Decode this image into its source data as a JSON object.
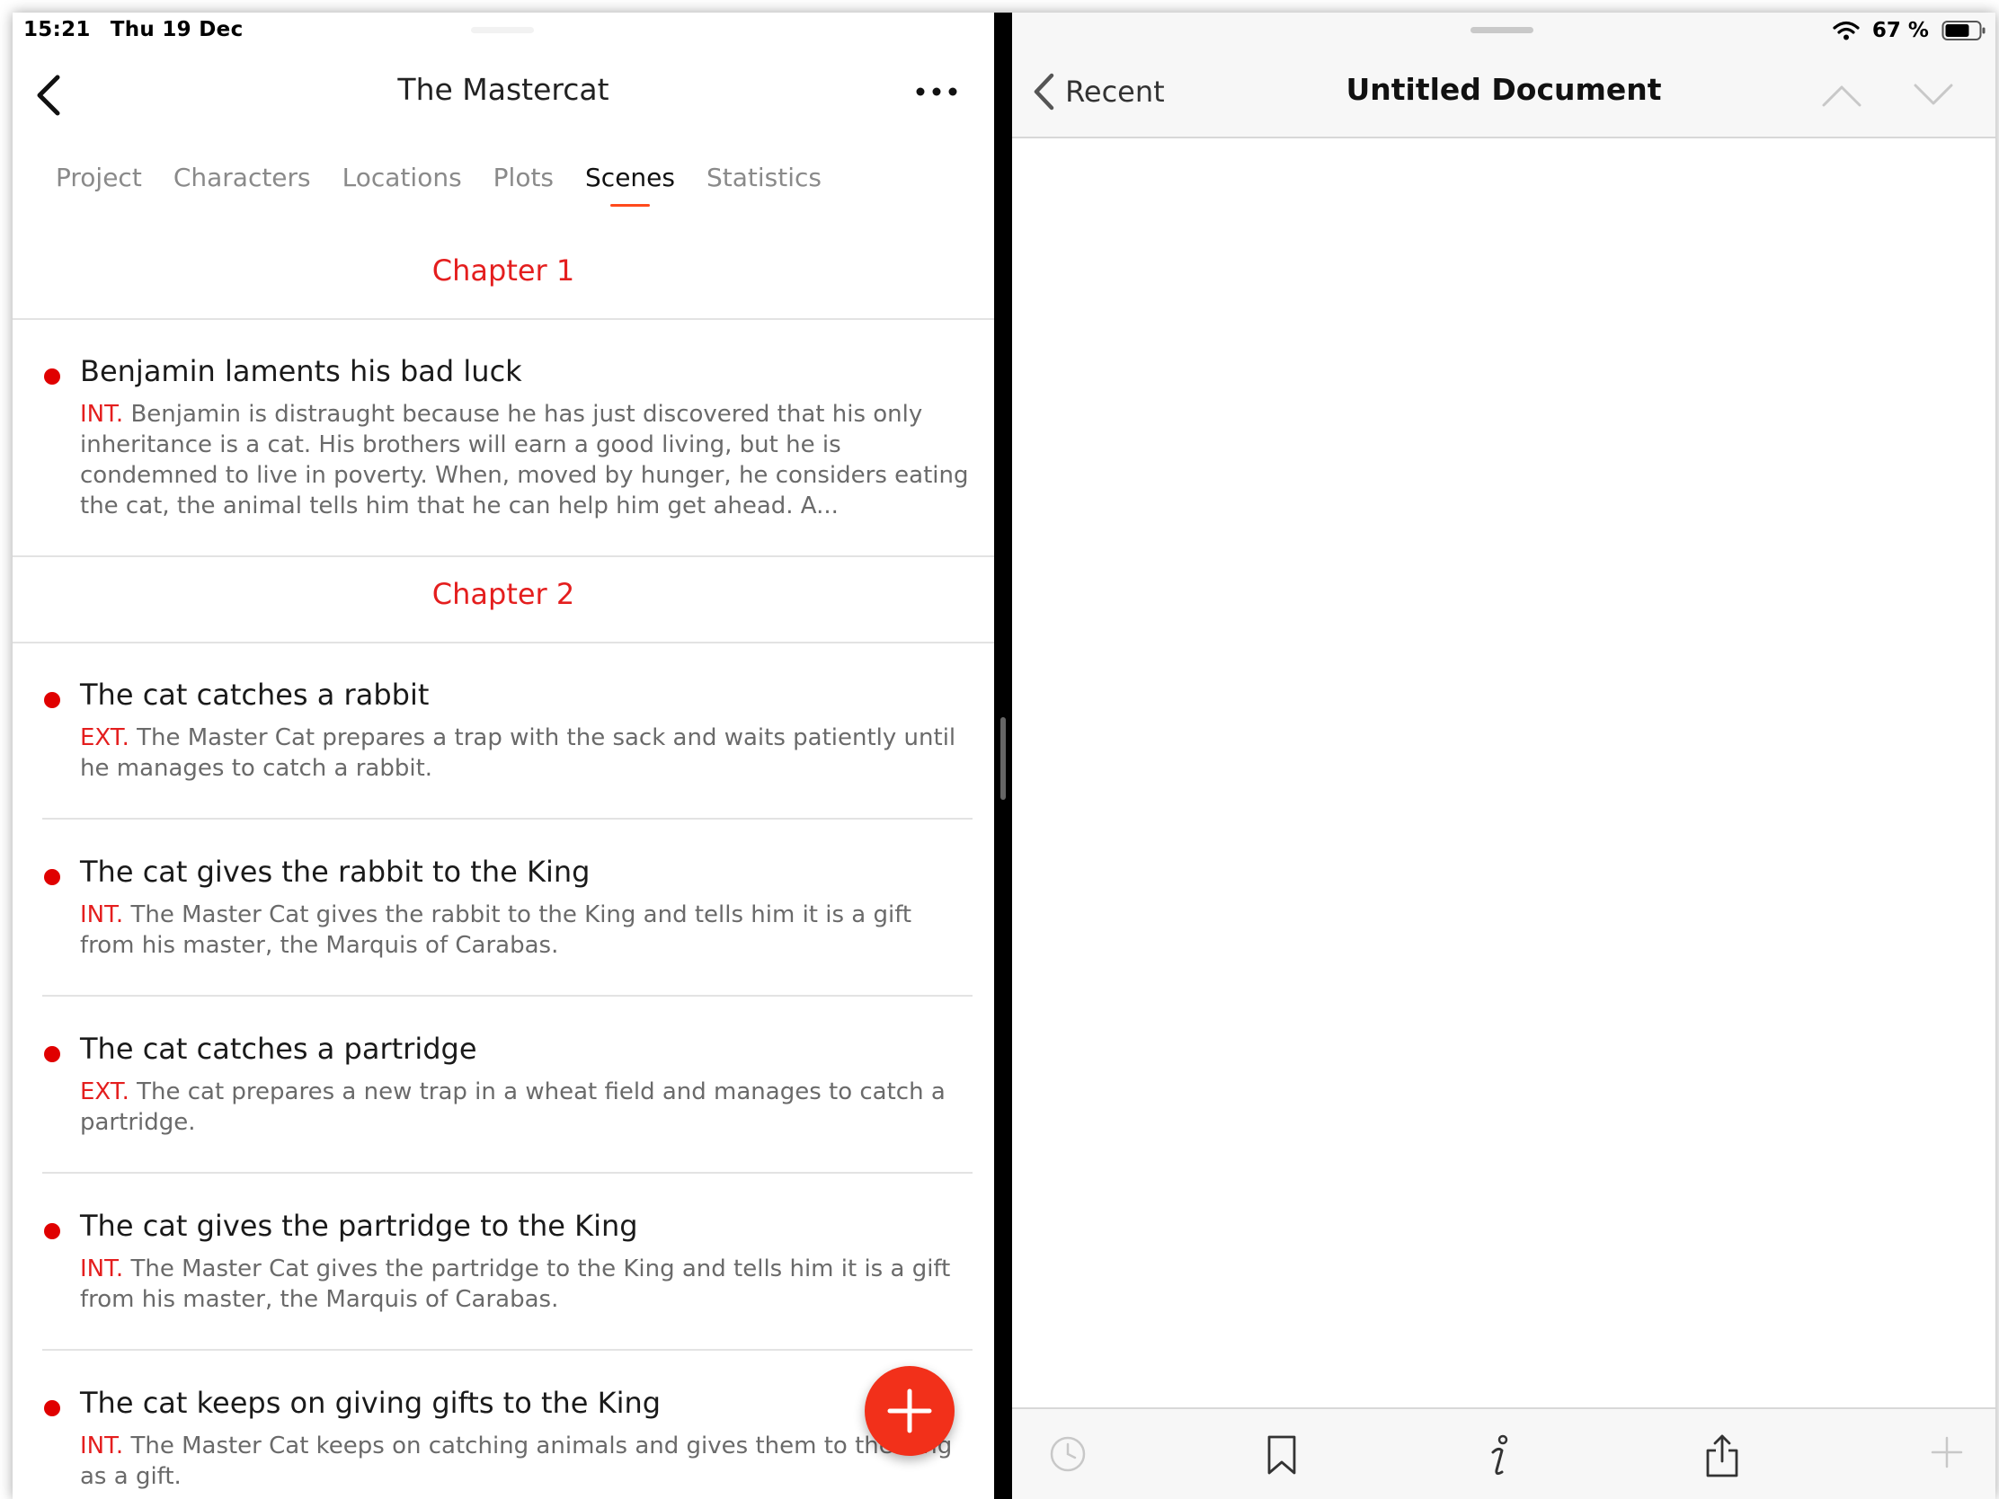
{
  "status_bar": {
    "time": "15:21",
    "date": "Thu 19 Dec",
    "battery_percent": "67 %",
    "icons": [
      "wifi-icon",
      "battery-icon"
    ]
  },
  "left_pane": {
    "title": "The Mastercat",
    "tabs": [
      {
        "label": "Project",
        "active": false
      },
      {
        "label": "Characters",
        "active": false
      },
      {
        "label": "Locations",
        "active": false
      },
      {
        "label": "Plots",
        "active": false
      },
      {
        "label": "Scenes",
        "active": true
      },
      {
        "label": "Statistics",
        "active": false
      }
    ],
    "chapters": [
      {
        "title": "Chapter 1",
        "scenes": [
          {
            "title": "Benjamin laments his bad luck",
            "tag": "INT.",
            "description": " Benjamin is distraught because he has just discovered that his only inheritance is a cat. His brothers will earn a good living, but he is condemned to live in poverty. When, moved by hunger, he considers eating the cat, the animal tells him that he can help him get ahead. A..."
          }
        ]
      },
      {
        "title": "Chapter 2",
        "scenes": [
          {
            "title": "The cat catches a rabbit",
            "tag": "EXT.",
            "description": " The Master Cat prepares a trap with the sack and waits patiently until he manages to catch a rabbit."
          },
          {
            "title": "The cat gives the rabbit to the King",
            "tag": "INT.",
            "description": " The Master Cat gives the rabbit to the King and tells him it is a gift from his master, the Marquis of Carabas."
          },
          {
            "title": "The cat catches a partridge",
            "tag": "EXT.",
            "description": " The cat prepares a new trap in a wheat field and manages to catch a partridge."
          },
          {
            "title": "The cat gives the partridge to the King",
            "tag": "INT.",
            "description": " The Master Cat gives the partridge to the King and tells him it is a gift from his master, the Marquis of Carabas."
          },
          {
            "title": "The cat keeps on giving gifts to the King",
            "tag": "INT.",
            "description": " The Master Cat keeps on catching animals and gives them to the King as a gift."
          }
        ]
      }
    ]
  },
  "right_pane": {
    "back_label": "Recent",
    "title": "Untitled Document"
  },
  "colors": {
    "accent_red": "#e41e1e",
    "fab_orange": "#f2301a",
    "tab_underline": "#ff4a1c"
  }
}
